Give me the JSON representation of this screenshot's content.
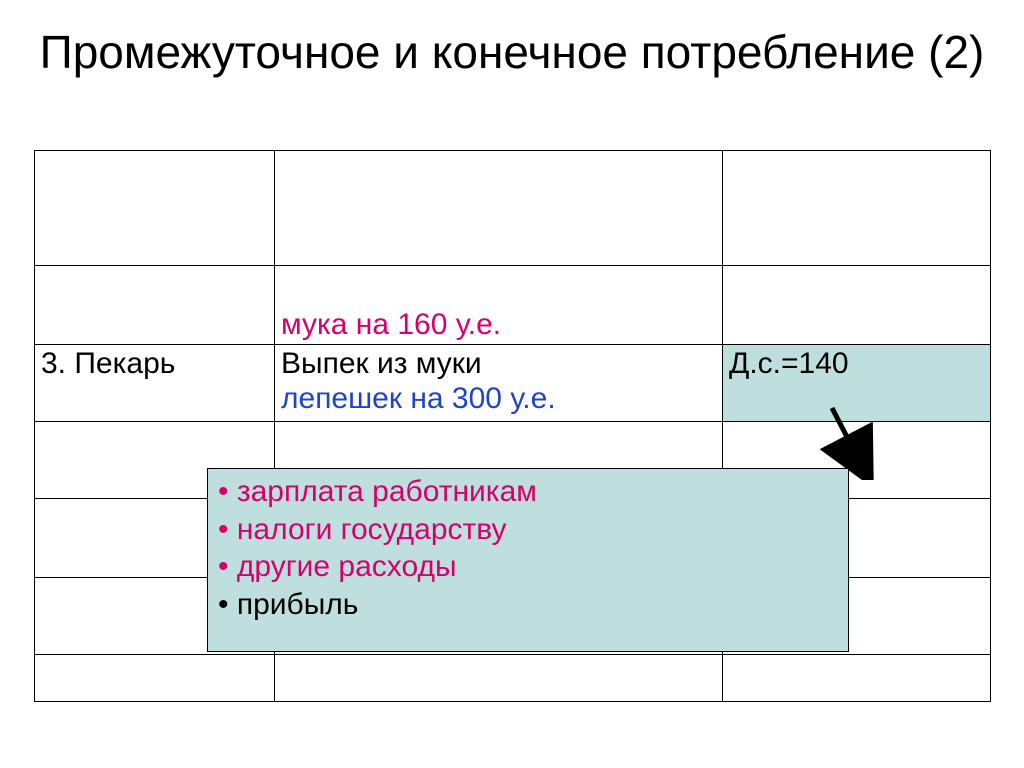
{
  "title": "Промежуточное и конечное потребление (2)",
  "table": {
    "row2_col2_muka": "мука на 160 у.е.",
    "row3_col1": "3. Пекарь",
    "row3_col2_black": "Выпек из муки ",
    "row3_col2_blue": "лепешек на 300 у.е.",
    "row3_col3_ds": "Д.с.=140"
  },
  "callout": {
    "item1": "зарплата работникам",
    "item2": "налоги государству",
    "item3": "другие расходы",
    "item4": "прибыль"
  }
}
